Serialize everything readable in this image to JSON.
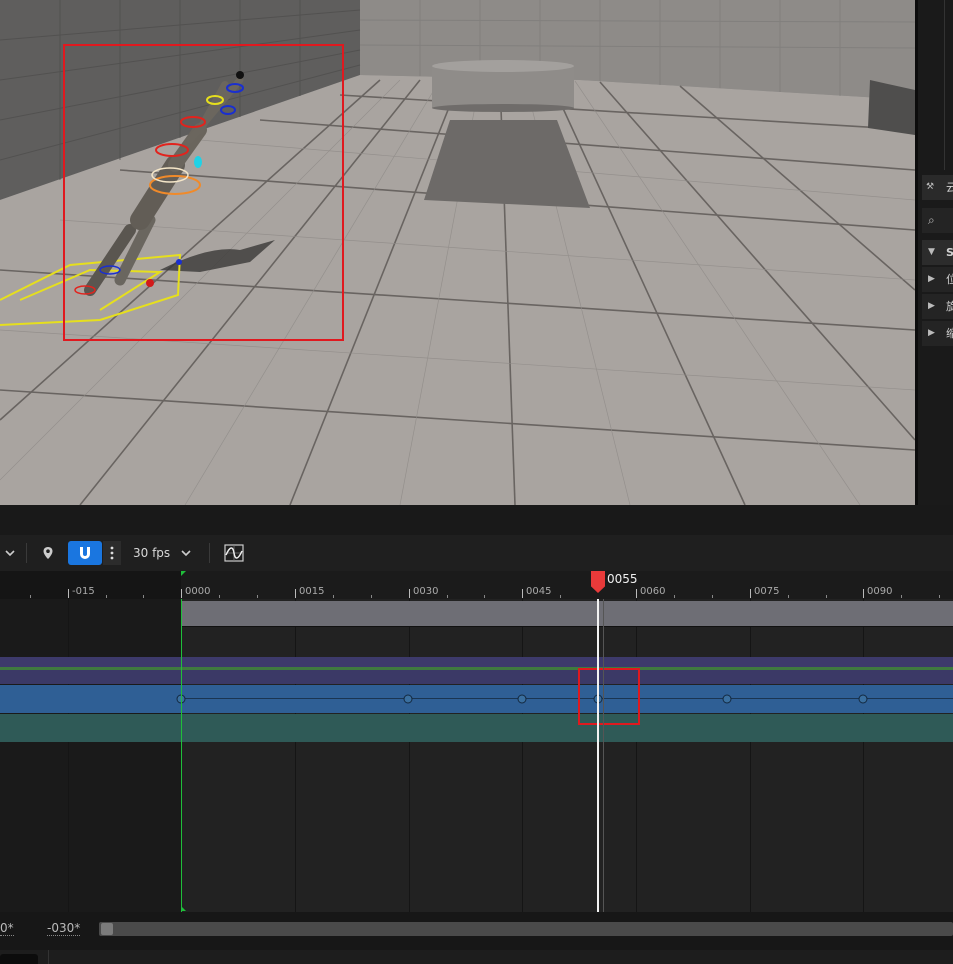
{
  "details": {
    "rows": [
      {
        "label": "云",
        "icon": "tools-icon"
      },
      {
        "label": "",
        "icon": "search-icon"
      },
      {
        "label": "SK",
        "icon": "triangle-down-icon"
      },
      {
        "label": "位",
        "icon": "triangle-right-icon"
      },
      {
        "label": "旋",
        "icon": "triangle-right-icon"
      },
      {
        "label": "缩",
        "icon": "triangle-right-icon"
      }
    ]
  },
  "toolbar": {
    "fps_label": "30 fps",
    "buttons": [
      "chevron-down-icon",
      "location-pin-icon",
      "magnet-snap-icon",
      "more-options-icon",
      "fps-dropdown",
      "curve-editor-icon"
    ]
  },
  "timeline": {
    "playhead_label": "0055",
    "ruler_labels": [
      "-015",
      "0000",
      "0015",
      "0030",
      "0045",
      "0060",
      "0075",
      "0090"
    ],
    "keyframe_frames": [
      0,
      30,
      45,
      55,
      72,
      90
    ]
  },
  "footer": {
    "range_start": "0*",
    "range_start2": "-030*"
  },
  "colors": {
    "selection_red": "#e0191f",
    "playhead": "#e83a3a",
    "track_blue": "#2f5f95",
    "track_teal": "#2f5a57",
    "track_purple": "#3d3a6b",
    "start_marker_green": "#1fbf3a",
    "snap_active": "#1a76e0"
  }
}
